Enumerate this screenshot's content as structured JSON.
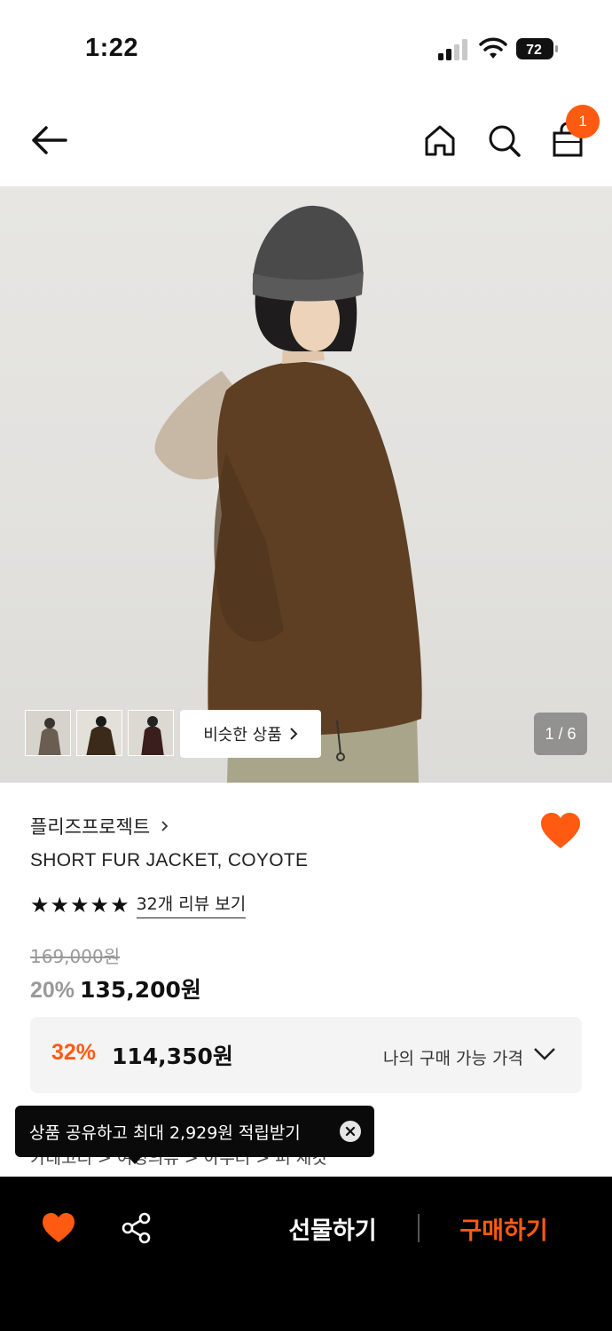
{
  "status_bar": {
    "time": "1:22",
    "battery": "72"
  },
  "header": {
    "cart_count": "1"
  },
  "gallery": {
    "similar_label": "비슷한 상품",
    "page_indicator": "1 / 6"
  },
  "product": {
    "brand": "플리즈프로젝트",
    "title": "SHORT FUR JACKET, COYOTE",
    "rating_stars": 5,
    "review_link": "32개 리뷰 보기",
    "original_price": "169,000원",
    "discount": "20%",
    "price": "135,200원"
  },
  "best_price": {
    "discount": "32%",
    "price": "114,350원",
    "label": "나의 구매 가능 가격"
  },
  "breadcrumb": "카테고리  >  여성의류  >  아우터  >  퍼 재킷",
  "tooltip": {
    "text": "상품 공유하고 최대 2,929원 적립받기"
  },
  "bottom_bar": {
    "gift_label": "선물하기",
    "buy_label": "구매하기"
  },
  "colors": {
    "accent": "#ff5a12",
    "bottom_bar": "#000000"
  }
}
